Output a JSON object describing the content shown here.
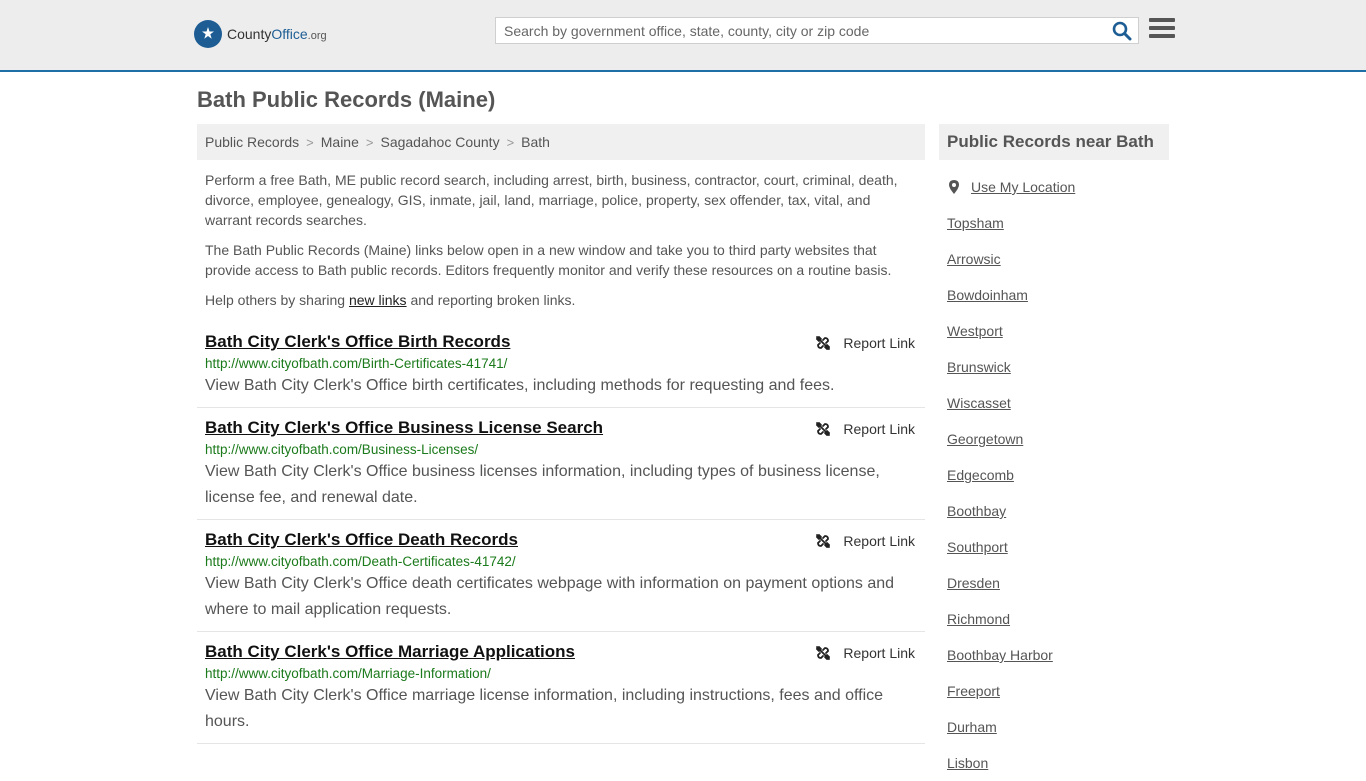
{
  "header": {
    "logo": {
      "name": "County",
      "name_bold": "Office",
      "tld": ".org"
    },
    "search_placeholder": "Search by government office, state, county, city or zip code"
  },
  "page_title": "Bath Public Records (Maine)",
  "breadcrumb": [
    "Public Records",
    "Maine",
    "Sagadahoc County",
    "Bath"
  ],
  "intro": {
    "p1": "Perform a free Bath, ME public record search, including arrest, birth, business, contractor, court, criminal, death, divorce, employee, genealogy, GIS, inmate, jail, land, marriage, police, property, sex offender, tax, vital, and warrant records searches.",
    "p2": "The Bath Public Records (Maine) links below open in a new window and take you to third party websites that provide access to Bath public records. Editors frequently monitor and verify these resources on a routine basis.",
    "p3_before": "Help others by sharing ",
    "p3_link": "new links",
    "p3_after": " and reporting broken links."
  },
  "report_label": "Report Link",
  "records": [
    {
      "title": "Bath City Clerk's Office Birth Records",
      "url": "http://www.cityofbath.com/Birth-Certificates-41741/",
      "desc": "View Bath City Clerk's Office birth certificates, including methods for requesting and fees."
    },
    {
      "title": "Bath City Clerk's Office Business License Search",
      "url": "http://www.cityofbath.com/Business-Licenses/",
      "desc": "View Bath City Clerk's Office business licenses information, including types of business license, license fee, and renewal date."
    },
    {
      "title": "Bath City Clerk's Office Death Records",
      "url": "http://www.cityofbath.com/Death-Certificates-41742/",
      "desc": "View Bath City Clerk's Office death certificates webpage with information on payment options and where to mail application requests."
    },
    {
      "title": "Bath City Clerk's Office Marriage Applications",
      "url": "http://www.cityofbath.com/Marriage-Information/",
      "desc": "View Bath City Clerk's Office marriage license information, including instructions, fees and office hours."
    }
  ],
  "sidebar": {
    "title": "Public Records near Bath",
    "use_location": "Use My Location",
    "places": [
      "Topsham",
      "Arrowsic",
      "Bowdoinham",
      "Westport",
      "Brunswick",
      "Wiscasset",
      "Georgetown",
      "Edgecomb",
      "Boothbay",
      "Southport",
      "Dresden",
      "Richmond",
      "Boothbay Harbor",
      "Freeport",
      "Durham",
      "Lisbon"
    ]
  },
  "colors": {
    "accent": "#1d6fa5",
    "url_green": "#1b7a1b",
    "header_bg": "#ededed"
  }
}
